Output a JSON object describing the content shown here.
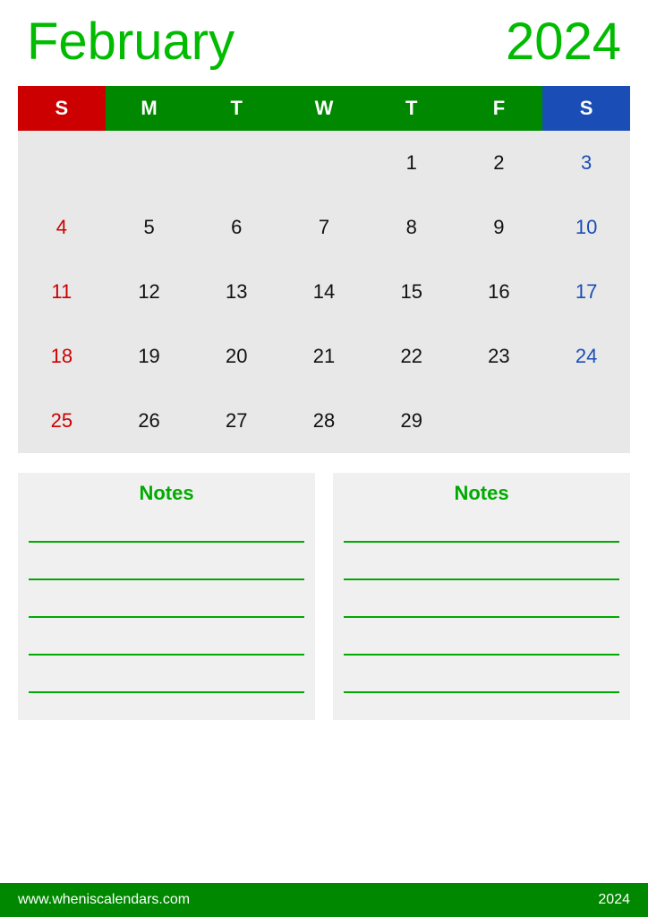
{
  "header": {
    "month": "February",
    "year": "2024"
  },
  "calendar": {
    "days_header": [
      {
        "label": "S",
        "type": "sunday"
      },
      {
        "label": "M",
        "type": "weekday"
      },
      {
        "label": "T",
        "type": "weekday"
      },
      {
        "label": "W",
        "type": "weekday"
      },
      {
        "label": "T",
        "type": "weekday"
      },
      {
        "label": "F",
        "type": "weekday"
      },
      {
        "label": "S",
        "type": "saturday"
      }
    ],
    "weeks": [
      [
        {
          "day": "",
          "type": "empty"
        },
        {
          "day": "",
          "type": "empty"
        },
        {
          "day": "",
          "type": "empty"
        },
        {
          "day": "",
          "type": "empty"
        },
        {
          "day": "1",
          "type": "weekday"
        },
        {
          "day": "2",
          "type": "weekday"
        },
        {
          "day": "3",
          "type": "saturday"
        }
      ],
      [
        {
          "day": "4",
          "type": "sunday"
        },
        {
          "day": "5",
          "type": "weekday"
        },
        {
          "day": "6",
          "type": "weekday"
        },
        {
          "day": "7",
          "type": "weekday"
        },
        {
          "day": "8",
          "type": "weekday"
        },
        {
          "day": "9",
          "type": "weekday"
        },
        {
          "day": "10",
          "type": "saturday"
        }
      ],
      [
        {
          "day": "11",
          "type": "sunday"
        },
        {
          "day": "12",
          "type": "weekday"
        },
        {
          "day": "13",
          "type": "weekday"
        },
        {
          "day": "14",
          "type": "weekday"
        },
        {
          "day": "15",
          "type": "weekday"
        },
        {
          "day": "16",
          "type": "weekday"
        },
        {
          "day": "17",
          "type": "saturday"
        }
      ],
      [
        {
          "day": "18",
          "type": "sunday"
        },
        {
          "day": "19",
          "type": "weekday"
        },
        {
          "day": "20",
          "type": "weekday"
        },
        {
          "day": "21",
          "type": "weekday"
        },
        {
          "day": "22",
          "type": "weekday"
        },
        {
          "day": "23",
          "type": "weekday"
        },
        {
          "day": "24",
          "type": "saturday"
        }
      ],
      [
        {
          "day": "25",
          "type": "sunday"
        },
        {
          "day": "26",
          "type": "weekday"
        },
        {
          "day": "27",
          "type": "weekday"
        },
        {
          "day": "28",
          "type": "weekday"
        },
        {
          "day": "29",
          "type": "weekday"
        },
        {
          "day": "",
          "type": "empty"
        },
        {
          "day": "",
          "type": "empty"
        }
      ]
    ]
  },
  "notes": {
    "left_label": "Notes",
    "right_label": "Notes",
    "lines_count": 5
  },
  "footer": {
    "url": "www.wheniscalendars.com",
    "year": "2024"
  }
}
